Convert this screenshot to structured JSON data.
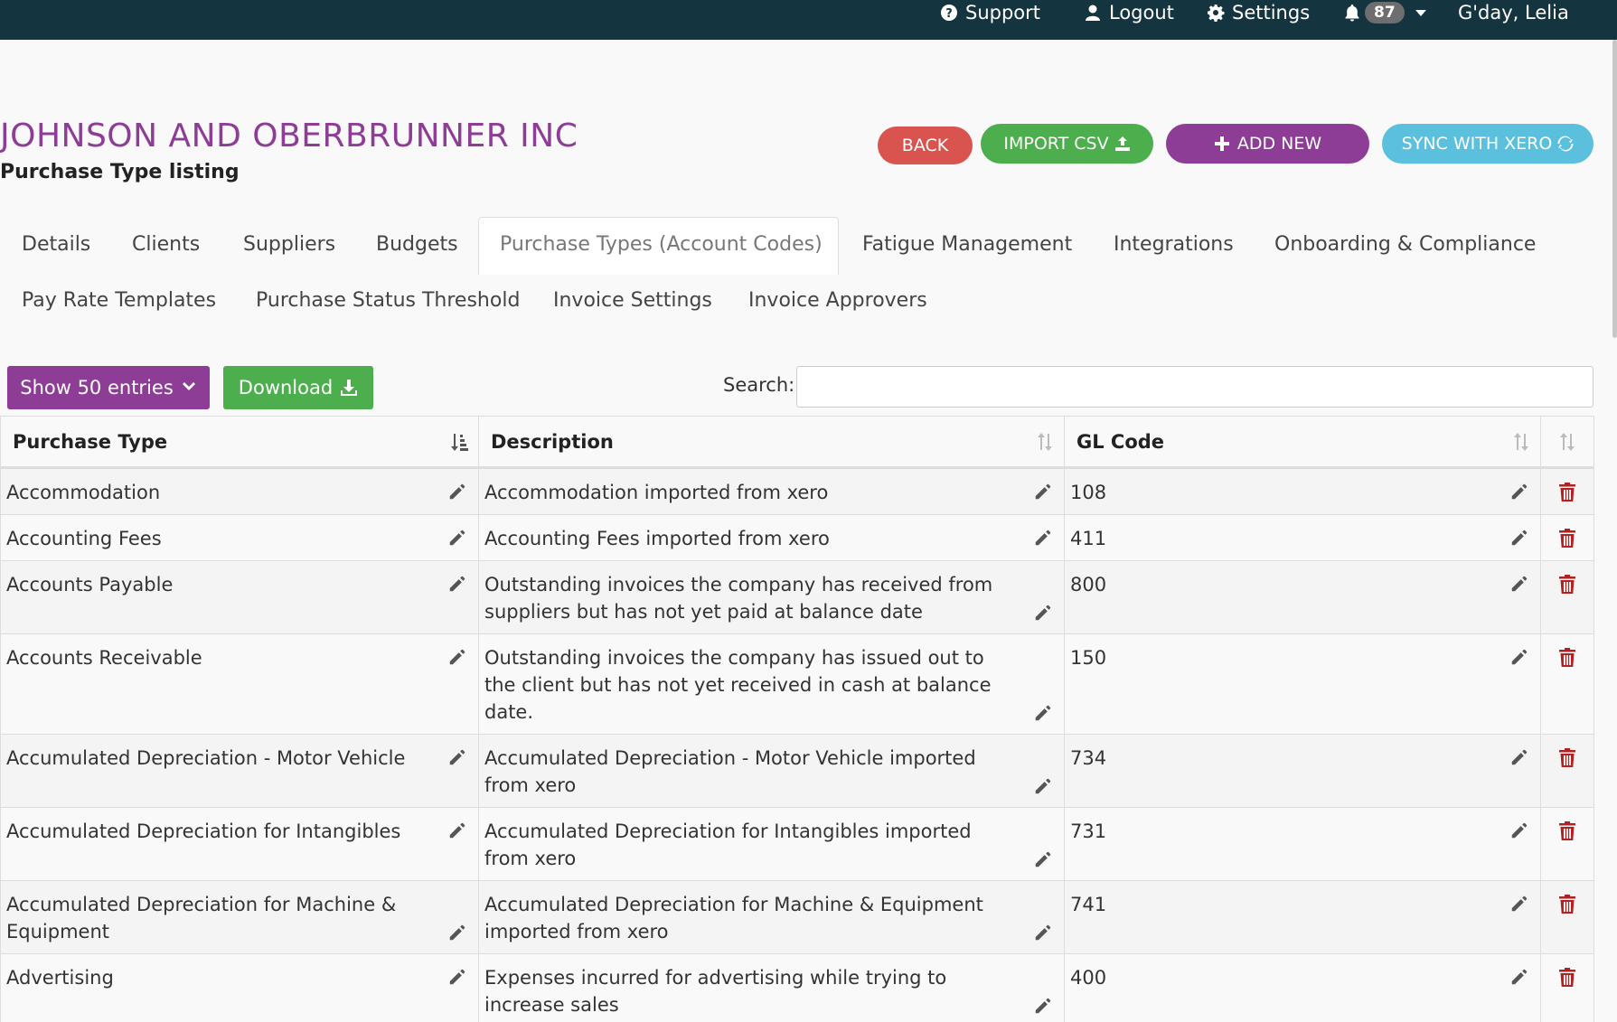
{
  "topbar": {
    "support": "Support",
    "logout": "Logout",
    "settings": "Settings",
    "notification_count": "87",
    "greeting": "G'day, Lelia"
  },
  "header": {
    "company": "JOHNSON AND OBERBRUNNER INC",
    "subtitle": "Purchase Type listing"
  },
  "actions": {
    "back": "BACK",
    "import_csv": "IMPORT CSV",
    "add_new": "ADD NEW",
    "sync": "SYNC WITH XERO"
  },
  "tabs": [
    {
      "label": "Details"
    },
    {
      "label": "Clients"
    },
    {
      "label": "Suppliers"
    },
    {
      "label": "Budgets"
    },
    {
      "label": "Purchase Types (Account Codes)",
      "active": true
    },
    {
      "label": "Fatigue Management"
    },
    {
      "label": "Integrations"
    },
    {
      "label": "Onboarding & Compliance"
    },
    {
      "label": "Pay Rate Templates"
    },
    {
      "label": "Purchase Status Threshold"
    },
    {
      "label": "Invoice Settings"
    },
    {
      "label": "Invoice Approvers"
    }
  ],
  "controls": {
    "show_entries": "Show 50 entries",
    "download": "Download",
    "search_label": "Search:",
    "search_value": ""
  },
  "table": {
    "columns": [
      "Purchase Type",
      "Description",
      "GL Code"
    ],
    "rows": [
      {
        "type": "Accommodation",
        "description": "Accommodation imported from xero",
        "code": "108"
      },
      {
        "type": "Accounting Fees",
        "description": "Accounting Fees imported from xero",
        "code": "411"
      },
      {
        "type": "Accounts Payable",
        "description": "Outstanding invoices the company has received from suppliers but has not yet paid at balance date",
        "code": "800"
      },
      {
        "type": "Accounts Receivable",
        "description": "Outstanding invoices the company has issued out to the client but has not yet received in cash at balance date.",
        "code": "150"
      },
      {
        "type": "Accumulated Depreciation - Motor Vehicle",
        "description": "Accumulated Depreciation - Motor Vehicle imported from xero",
        "code": "734"
      },
      {
        "type": "Accumulated Depreciation for Intangibles",
        "description": "Accumulated Depreciation for Intangibles imported from xero",
        "code": "731"
      },
      {
        "type": "Accumulated Depreciation for Machine & Equipment",
        "description": "Accumulated Depreciation for Machine & Equipment imported from xero",
        "code": "741"
      },
      {
        "type": "Advertising",
        "description": "Expenses incurred for advertising while trying to increase sales",
        "code": "400"
      }
    ]
  },
  "colors": {
    "topbar": "#14343f",
    "brand_purple": "#8e3d96",
    "green": "#4cae4c",
    "red": "#d9534f",
    "cyan": "#5bc0de",
    "delete": "#b22222"
  }
}
